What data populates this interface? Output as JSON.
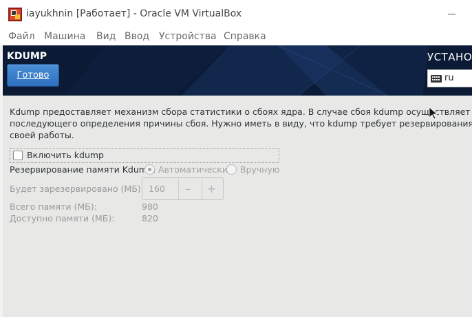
{
  "window": {
    "title": "iayukhnin [Работает] - Oracle VM VirtualBox"
  },
  "menu": {
    "items": [
      "Файл",
      "Машина",
      "Вид",
      "Ввод",
      "Устройства",
      "Справка"
    ]
  },
  "header": {
    "section_title": "KDUMP",
    "done_label": "Готово",
    "install_title": "УСТАНОВ",
    "keyboard_layout": "ru",
    "keyboard_icon": "keyboard-icon"
  },
  "content": {
    "description_lines": [
      "Kdump предоставляет механизм сбора статистики о сбоях ядра. В случае сбоя kdump осуществляет сбор стати",
      "последующего определения причины сбоя. Нужно иметь в виду, что kdump требует резервирования части си",
      "своей работы."
    ],
    "enable_kdump_label": "Включить kdump",
    "enable_kdump_checked": false,
    "reservation_label": "Резервирование памяти Kdump:",
    "reservation_options": [
      {
        "label": "Автоматически",
        "selected": true
      },
      {
        "label": "Вручную",
        "selected": false
      }
    ],
    "reserved_label": "Будет зарезервировано (МБ):",
    "reserved_value": "160",
    "decrement_symbol": "–",
    "increment_symbol": "+",
    "total_memory_label": "Всего памяти (МБ):",
    "total_memory_value": "980",
    "available_memory_label": "Доступно памяти (МБ):",
    "available_memory_value": "820"
  },
  "colors": {
    "header_bg": "#0b1a35",
    "done_button": "#3a7fcb",
    "guest_bg": "#e8e8e7"
  }
}
